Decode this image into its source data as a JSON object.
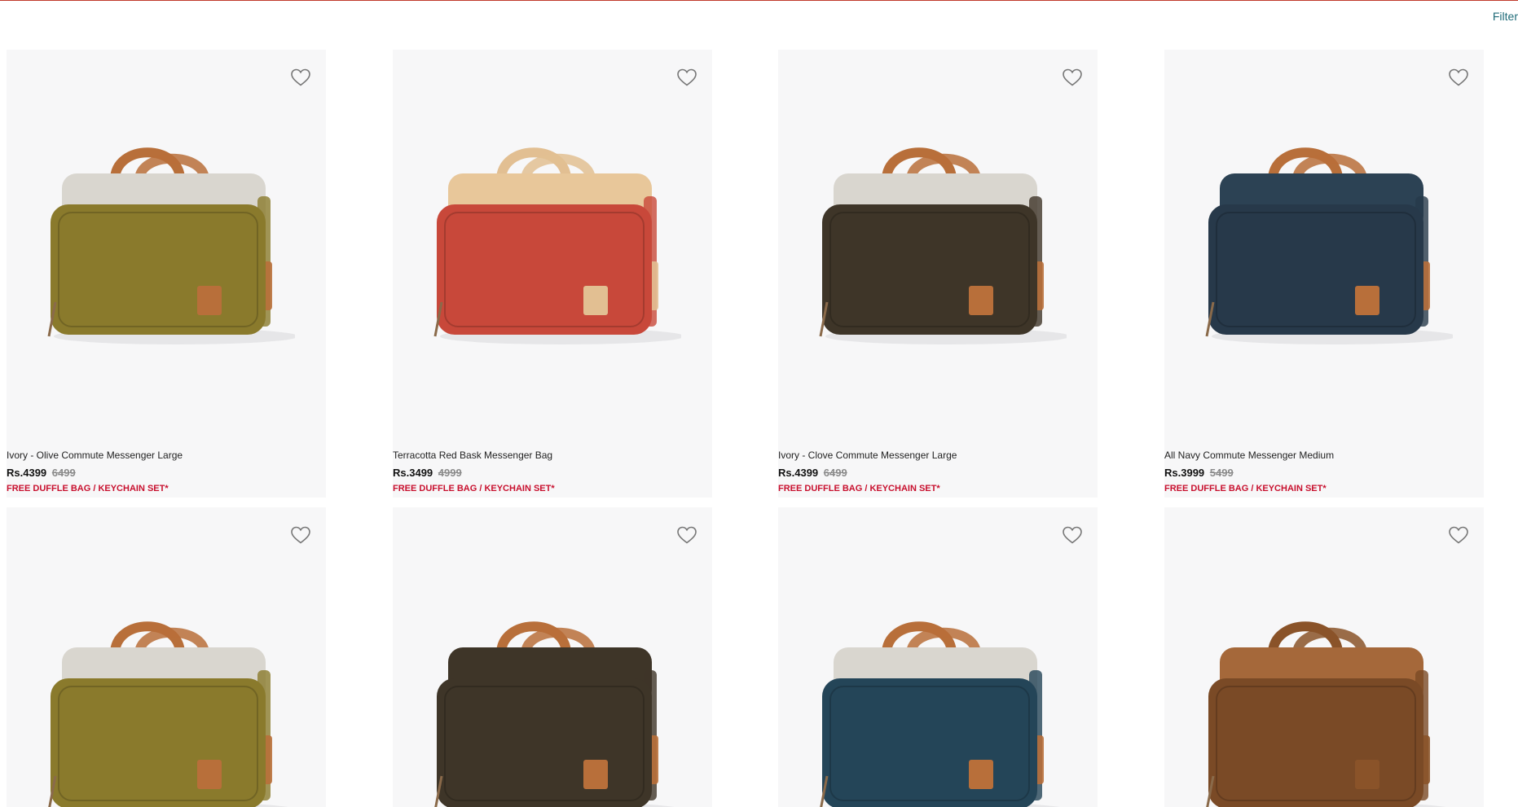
{
  "header": {
    "filter_label": "Filter"
  },
  "products": [
    {
      "name": "Ivory - Olive Commute Messenger Large",
      "price": "Rs.4399",
      "mrp": "6499",
      "offer": "FREE DUFFLE BAG / KEYCHAIN SET*",
      "body_color": "#8a7a2c",
      "top_color": "#d9d6cf",
      "handle_color": "#b86f3a"
    },
    {
      "name": "Terracotta Red Bask Messenger Bag",
      "price": "Rs.3499",
      "mrp": "4999",
      "offer": "FREE DUFFLE BAG / KEYCHAIN SET*",
      "body_color": "#c8483a",
      "top_color": "#e8c79a",
      "handle_color": "#e2bf92"
    },
    {
      "name": "Ivory - Clove Commute Messenger Large",
      "price": "Rs.4399",
      "mrp": "6499",
      "offer": "FREE DUFFLE BAG / KEYCHAIN SET*",
      "body_color": "#3e3528",
      "top_color": "#d9d6cf",
      "handle_color": "#b86f3a"
    },
    {
      "name": "All Navy Commute Messenger Medium",
      "price": "Rs.3999",
      "mrp": "5499",
      "offer": "FREE DUFFLE BAG / KEYCHAIN SET*",
      "body_color": "#27394a",
      "top_color": "#2c4254",
      "handle_color": "#b86f3a"
    },
    {
      "name": "",
      "price": "",
      "mrp": "",
      "offer": "",
      "body_color": "#8a7a2c",
      "top_color": "#d9d6cf",
      "handle_color": "#b86f3a"
    },
    {
      "name": "",
      "price": "",
      "mrp": "",
      "offer": "",
      "body_color": "#3e3528",
      "top_color": "#3e3528",
      "handle_color": "#b86f3a"
    },
    {
      "name": "",
      "price": "",
      "mrp": "",
      "offer": "",
      "body_color": "#244558",
      "top_color": "#d9d6cf",
      "handle_color": "#b86f3a"
    },
    {
      "name": "",
      "price": "",
      "mrp": "",
      "offer": "",
      "body_color": "#7a4a26",
      "top_color": "#a5683a",
      "handle_color": "#8a5329"
    }
  ],
  "icons": {
    "wishlist": "heart-outline-icon"
  }
}
